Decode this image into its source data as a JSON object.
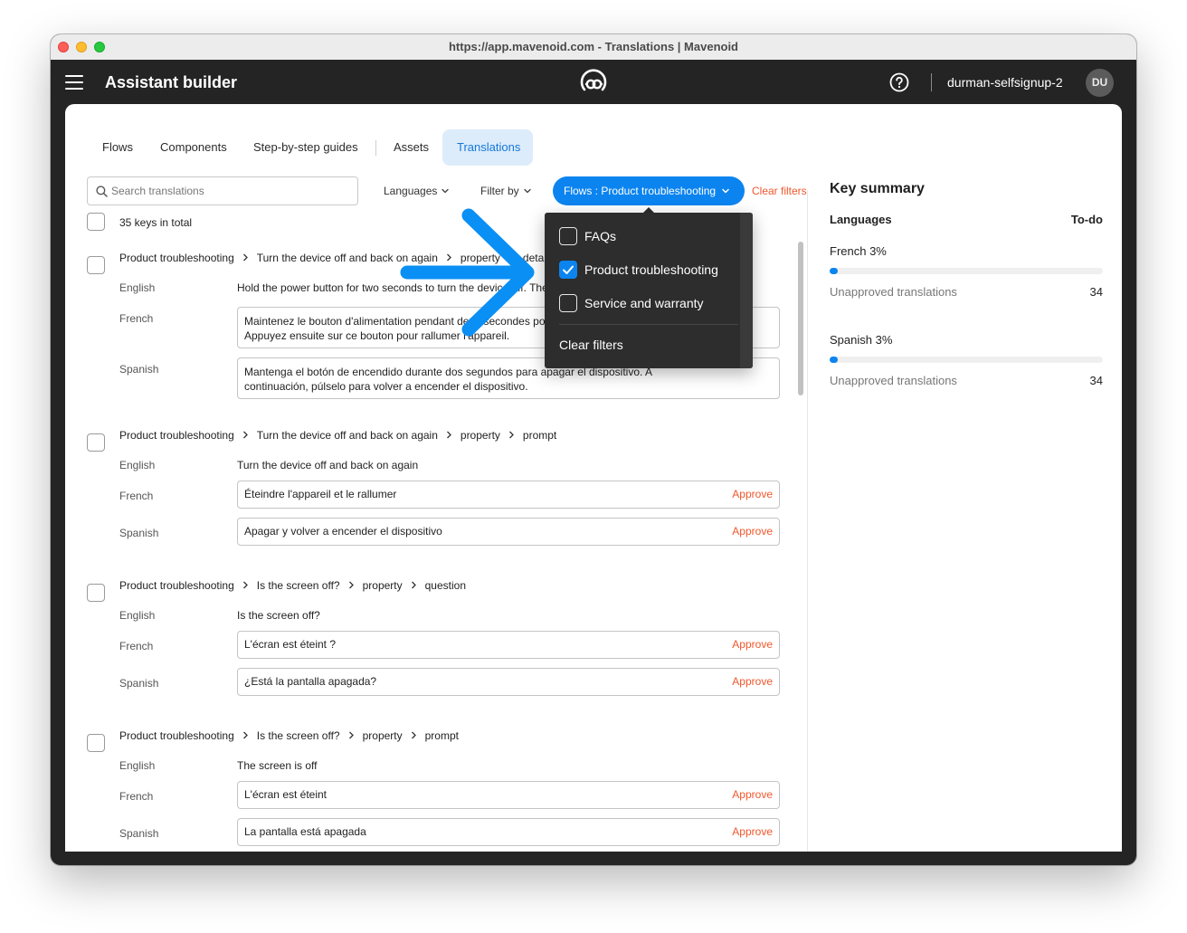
{
  "window": {
    "title": "https://app.mavenoid.com - Translations | Mavenoid"
  },
  "appbar": {
    "title": "Assistant builder",
    "org": "durman-selfsignup-2",
    "avatar": "DU"
  },
  "tabs": [
    {
      "label": "Flows"
    },
    {
      "label": "Components"
    },
    {
      "label": "Step-by-step guides"
    },
    {
      "label": "Assets"
    },
    {
      "label": "Translations",
      "active": true
    }
  ],
  "toolbar": {
    "search_placeholder": "Search translations",
    "languages_label": "Languages",
    "filter_label": "Filter by",
    "flows_chip": "Flows : Product troubleshooting",
    "clear_filters": "Clear filters"
  },
  "keys_total": "35 keys in total",
  "dropdown": {
    "options": [
      {
        "label": "FAQs",
        "checked": false
      },
      {
        "label": "Product troubleshooting",
        "checked": true
      },
      {
        "label": "Service and warranty",
        "checked": false
      }
    ],
    "clear": "Clear filters"
  },
  "languages": {
    "english": "English",
    "french": "French",
    "spanish": "Spanish"
  },
  "approve_label": "Approve",
  "entries": [
    {
      "crumbs": [
        "Product troubleshooting",
        "Turn the device off and back on again",
        "property",
        "details"
      ],
      "english": "Hold the power button for two seconds to turn the device off. Then press it again to turn the device back on.",
      "french": "Maintenez le bouton d'alimentation pendant deux secondes pour éteindre l'appareil.\nAppuyez ensuite sur ce bouton pour rallumer l'appareil.",
      "spanish": "Mantenga el botón de encendido durante dos segundos para apagar el dispositivo. A\ncontinuación, púlselo para volver a encender el dispositivo."
    },
    {
      "crumbs": [
        "Product troubleshooting",
        "Turn the device off and back on again",
        "property",
        "prompt"
      ],
      "english": "Turn the device off and back on again",
      "french": "Éteindre l'appareil et le rallumer",
      "spanish": "Apagar y volver a encender el dispositivo"
    },
    {
      "crumbs": [
        "Product troubleshooting",
        "Is the screen off?",
        "property",
        "question"
      ],
      "english": "Is the screen off?",
      "french": "L'écran est éteint ?",
      "spanish": "¿Está la pantalla apagada?"
    },
    {
      "crumbs": [
        "Product troubleshooting",
        "Is the screen off?",
        "property",
        "prompt"
      ],
      "english": "The screen is off",
      "french": "L'écran est éteint",
      "spanish": "La pantalla está apagada"
    }
  ],
  "summary": {
    "title": "Key summary",
    "col_languages": "Languages",
    "col_todo": "To-do",
    "items": [
      {
        "name": "French 3%",
        "progress": 0.03,
        "label": "Unapproved translations",
        "count": "34"
      },
      {
        "name": "Spanish 3%",
        "progress": 0.03,
        "label": "Unapproved translations",
        "count": "34"
      }
    ]
  },
  "colors": {
    "accent": "#0c84ef",
    "approve": "#f0572c",
    "appbar": "#242424",
    "active_tab_bg": "#dcecfa"
  }
}
